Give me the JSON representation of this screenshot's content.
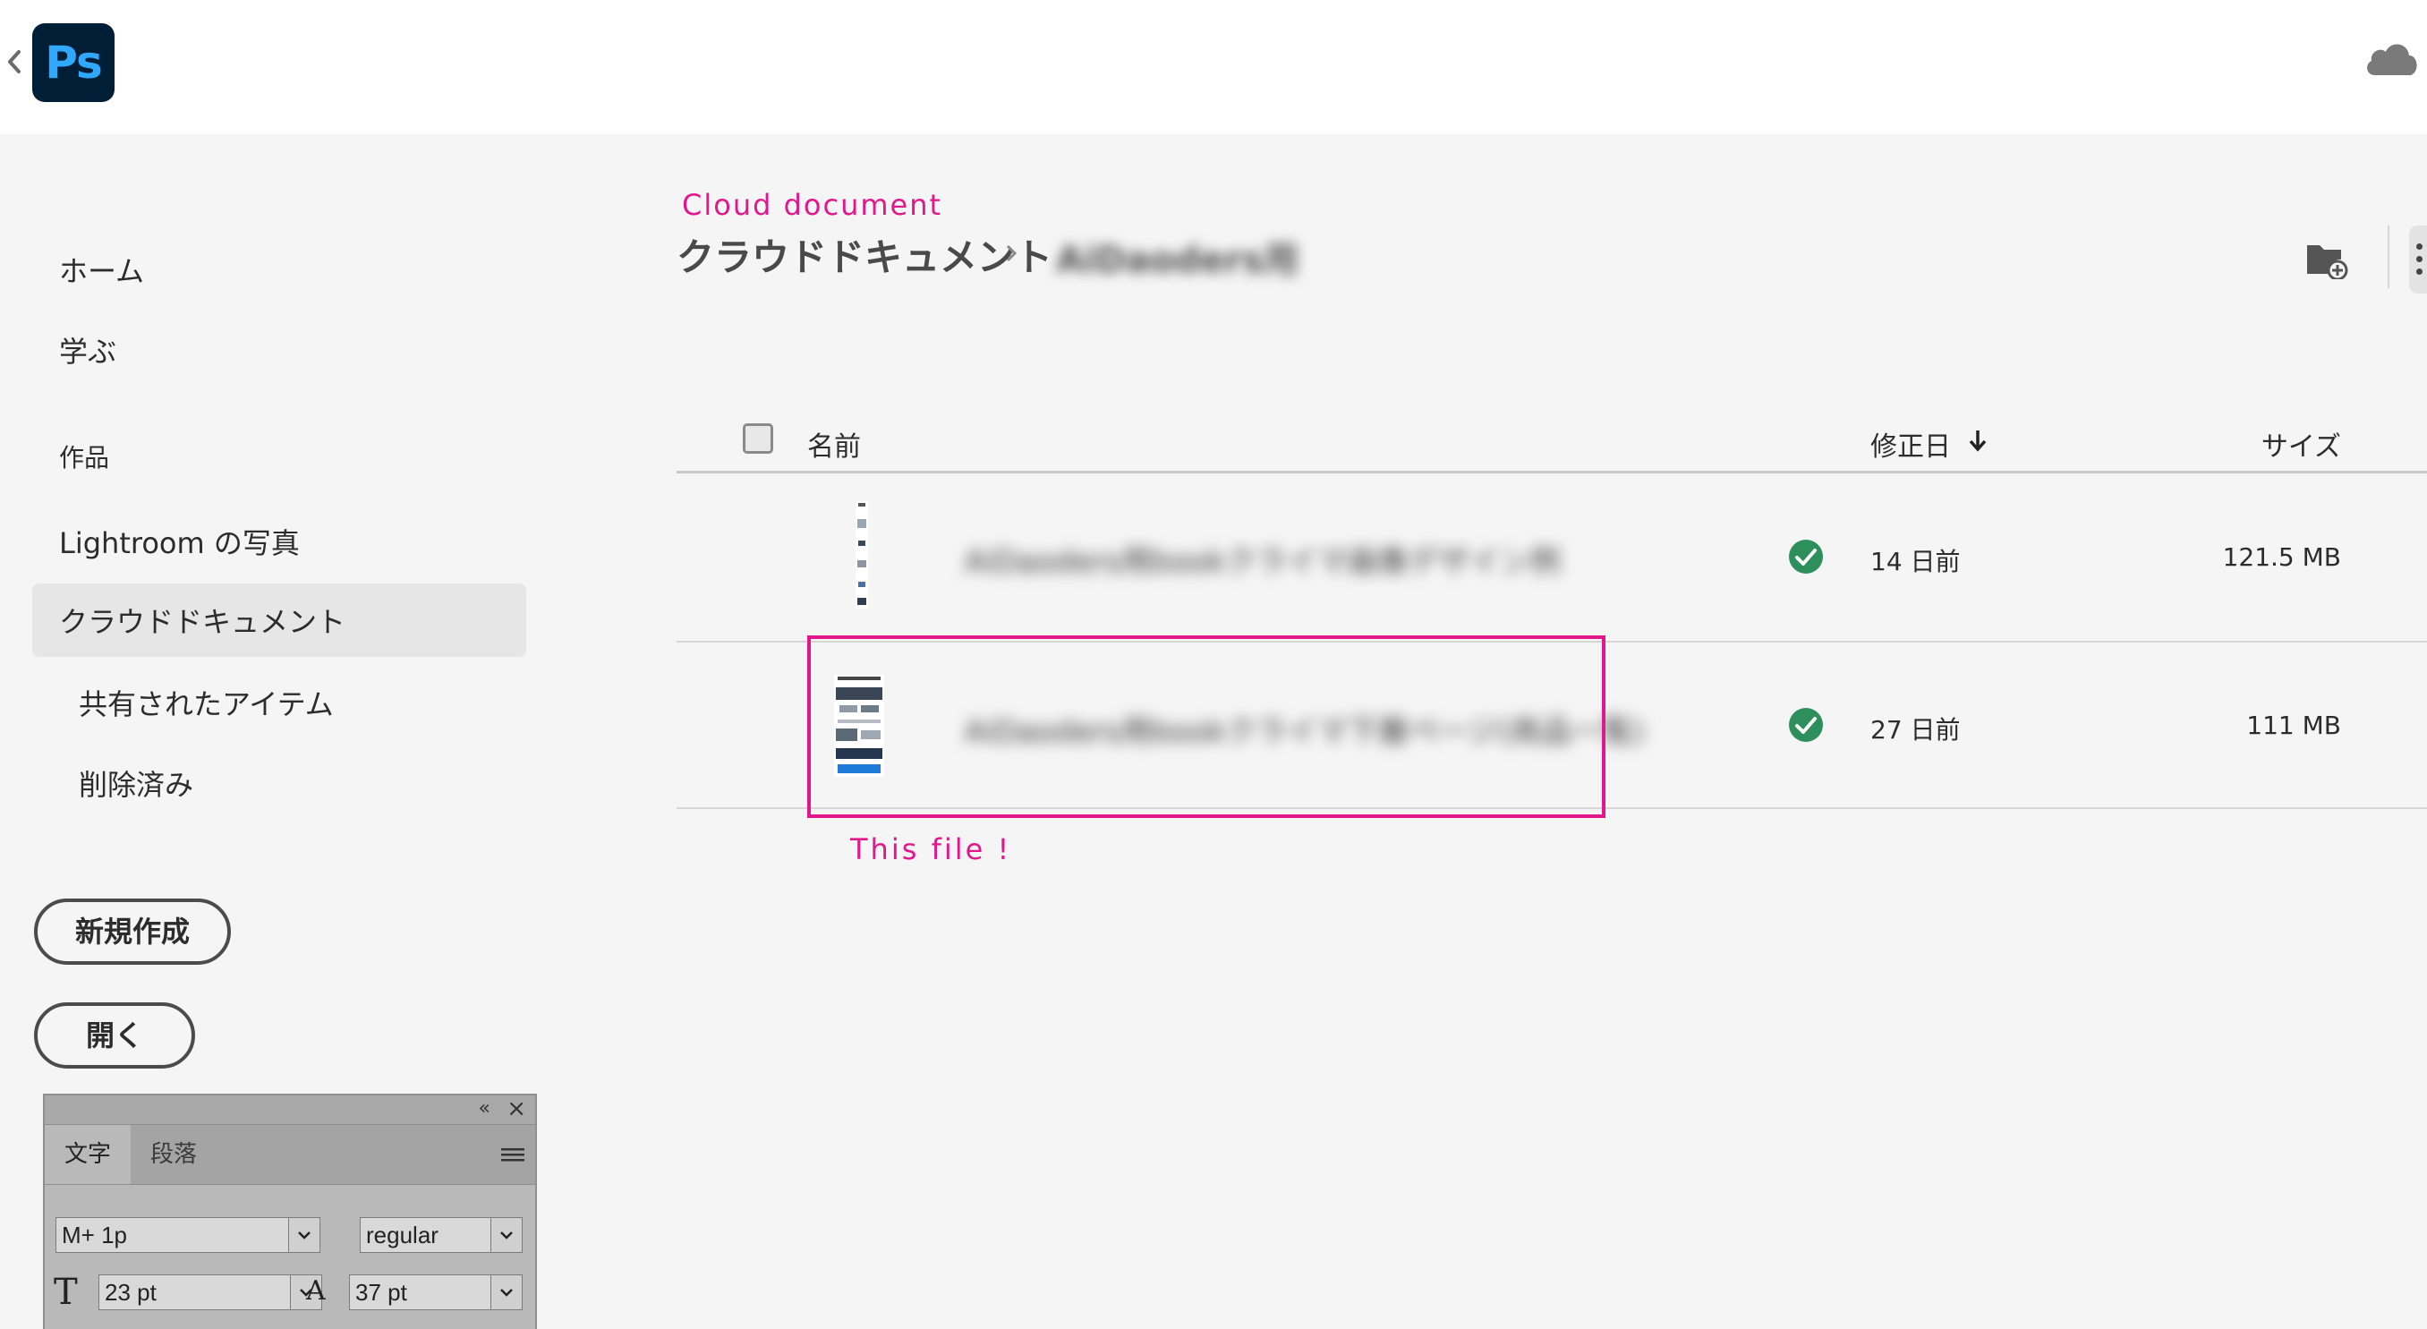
{
  "app": {
    "logo_text": "Ps",
    "icons": {
      "back": "chevron-left-icon",
      "cloud": "cloud-icon"
    }
  },
  "sidebar": {
    "home": "ホーム",
    "learn": "学ぶ",
    "section_works": "作品",
    "lightroom": "Lightroom の写真",
    "cloud_documents": "クラウドドキュメント",
    "shared_items": "共有されたアイテム",
    "deleted": "削除済み",
    "new_button": "新規作成",
    "open_button": "開く",
    "active_item": "クラウドドキュメント"
  },
  "annotations": {
    "cloud_document_note": "Cloud document",
    "this_file_note": "This file !",
    "highlight_color": "#e0188c"
  },
  "breadcrumb": {
    "root": "クラウドドキュメント",
    "folder": "AiDaoders用"
  },
  "table": {
    "headers": {
      "name": "名前",
      "modified": "修正日",
      "size": "サイズ"
    },
    "sort": {
      "column": "modified",
      "direction": "descending"
    },
    "rows": [
      {
        "name": "AiDaoders用bookクライマ画像デザイン例",
        "synced": true,
        "modified": "14 日前",
        "size": "121.5 MB"
      },
      {
        "name": "AiDaoders用bookクライマ下層ページ(商品一覧)",
        "synced": true,
        "modified": "27 日前",
        "size": "111 MB"
      }
    ]
  },
  "char_panel": {
    "tab_character": "文字",
    "tab_paragraph": "段落",
    "font_family": "M+ 1p",
    "font_style": "regular",
    "font_size": "23 pt",
    "leading": "37 pt"
  },
  "colors": {
    "ps_logo_bg": "#001e36",
    "ps_logo_text": "#31a8ff",
    "sync_check": "#2d8f5c",
    "annotation": "#e0188c"
  }
}
